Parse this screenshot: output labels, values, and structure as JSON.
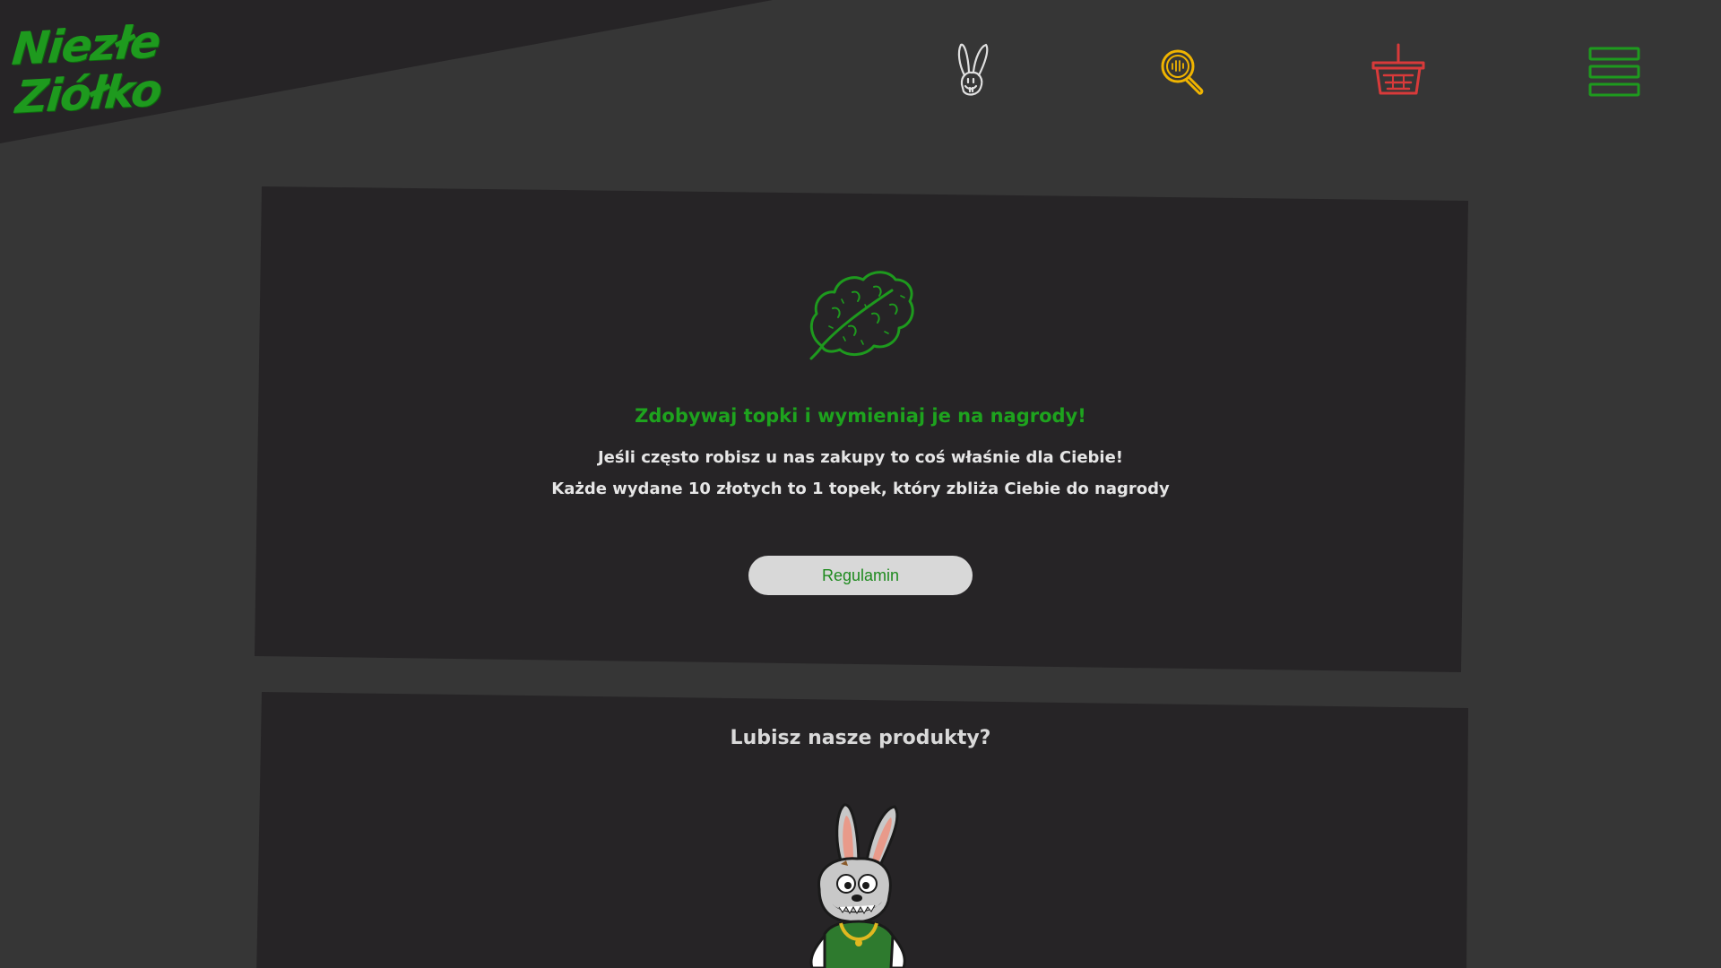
{
  "brand": {
    "logo_line1": "Niezłe",
    "logo_line2": "Ziółko"
  },
  "nav": {
    "items": [
      {
        "icon": "rabbit-icon",
        "color": "#e0e0e0"
      },
      {
        "icon": "search-icon",
        "color": "#f0b400"
      },
      {
        "icon": "basket-icon",
        "color": "#d83a3a"
      },
      {
        "icon": "menu-icon",
        "color": "#1e9a1e"
      }
    ]
  },
  "promo": {
    "icon": "leaf-icon",
    "title": "Zdobywaj topki i wymieniaj je na nagrody!",
    "line1": "Jeśli często robisz u nas zakupy to coś właśnie dla Ciebie!",
    "line2": "Każde wydane 10 złotych to 1 topek, który zbliża Ciebie do nagrody",
    "button_label": "Regulamin"
  },
  "section2": {
    "title": "Lubisz nasze produkty?",
    "image": "rabbit-mascot"
  },
  "colors": {
    "background": "#363636",
    "card": "#262426",
    "accent_green": "#1ea31e",
    "header_dark": "#262426"
  }
}
